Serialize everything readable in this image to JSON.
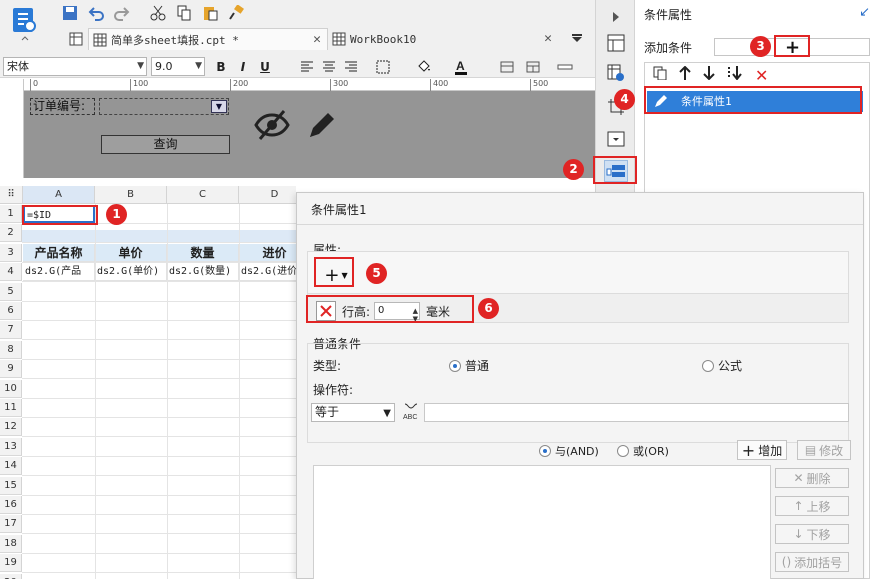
{
  "toolbar": {
    "tabs": [
      {
        "label": "简单多sheet填报.cpt *"
      },
      {
        "label": "WorkBook10"
      }
    ]
  },
  "format_bar": {
    "font_family": "宋体",
    "font_size": "9.0"
  },
  "ruler": {
    "ticks": [
      "0",
      "100",
      "200",
      "300",
      "400",
      "500"
    ]
  },
  "param_pane": {
    "label": "订单编号:",
    "query_button": "查询"
  },
  "sheet": {
    "columns": [
      "A",
      "B",
      "C",
      "D"
    ],
    "rows": [
      "1",
      "2",
      "3",
      "4",
      "5",
      "6",
      "7",
      "8",
      "9",
      "10",
      "11",
      "12",
      "13",
      "14",
      "15",
      "16",
      "17",
      "18",
      "19",
      "20"
    ],
    "cell_a1": "=$ID",
    "headers": [
      "产品名称",
      "单价",
      "数量",
      "进价"
    ],
    "data_cells": [
      "ds2.G(产品",
      "ds2.G(单价)",
      "ds2.G(数量)",
      "ds2.G(进价"
    ]
  },
  "right_panel": {
    "title": "条件属性",
    "add_condition_label": "添加条件",
    "condition_items": [
      "条件属性1"
    ]
  },
  "dialog": {
    "title": "条件属性1",
    "attributes_label": "属性:",
    "attr_row": {
      "name": "行高:",
      "value": "0",
      "unit": "毫米"
    },
    "normal_condition_label": "普通条件",
    "type_label": "类型:",
    "type_options": {
      "normal": "普通",
      "formula": "公式"
    },
    "operator_label": "操作符:",
    "operator_value": "等于",
    "logic": {
      "and": "与(AND)",
      "or": "或(OR)"
    },
    "buttons": {
      "add": "增加",
      "modify": "修改",
      "delete": "删除",
      "move_up": "上移",
      "move_down": "下移",
      "add_bracket": "添加括号"
    }
  },
  "annotations": [
    "1",
    "2",
    "3",
    "4",
    "5",
    "6"
  ],
  "colors": {
    "accent": "#2f7fd9",
    "annotation": "#e02424",
    "header_fill": "#dbeaf7"
  }
}
